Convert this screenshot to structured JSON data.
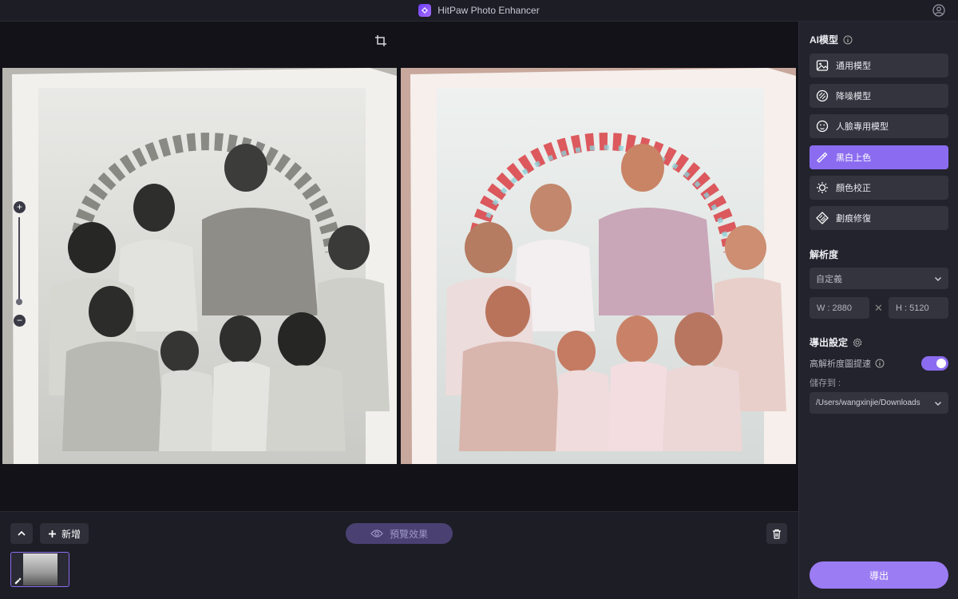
{
  "window": {
    "title": "HitPaw Photo Enhancer"
  },
  "canvas": {
    "zoom_in": "+",
    "zoom_out": "−",
    "zoom_level": 0.1
  },
  "bottom": {
    "add_label": "新增",
    "preview_label": "預覽效果"
  },
  "panel": {
    "ai_model_title": "AI模型",
    "models": [
      {
        "label": "通用模型",
        "icon": "image-icon",
        "active": false
      },
      {
        "label": "降噪模型",
        "icon": "denoise-icon",
        "active": false
      },
      {
        "label": "人臉專用模型",
        "icon": "face-icon",
        "active": false
      },
      {
        "label": "黑白上色",
        "icon": "colorize-icon",
        "active": true
      },
      {
        "label": "顏色校正",
        "icon": "color-correct-icon",
        "active": false
      },
      {
        "label": "劃痕修復",
        "icon": "scratch-repair-icon",
        "active": false
      }
    ],
    "resolution_title": "解析度",
    "resolution_value": "自定義",
    "width": "W : 2880",
    "height": "H : 5120",
    "dim_separator": "✕",
    "export_settings_title": "導出設定",
    "hires_label": "高解析度圖提速",
    "hires_on": true,
    "save_to_label": "儲存到 :",
    "save_path": "/Users/wangxinjie/Downloads",
    "export_label": "導出"
  },
  "colors": {
    "accent": "#8b6cf0",
    "panel_bg": "#23232d",
    "canvas_bg": "#121218"
  }
}
